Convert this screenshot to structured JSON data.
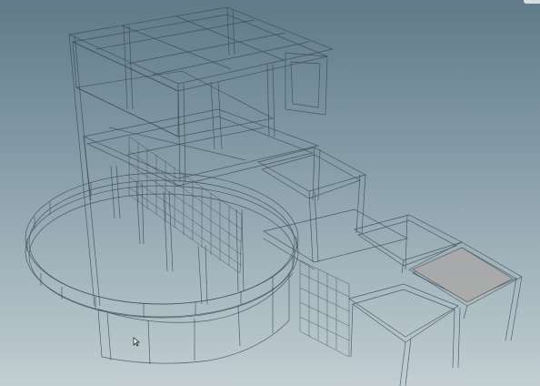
{
  "viewport": {
    "background_top": "#5f7a88",
    "background_bottom": "#c2ced2",
    "wire_color": "#3a4650",
    "selected_face_color": "#a9a9a9"
  },
  "icons": {
    "cursor": "mouse-pointer-icon",
    "corner": "viewport-corner-handle"
  }
}
